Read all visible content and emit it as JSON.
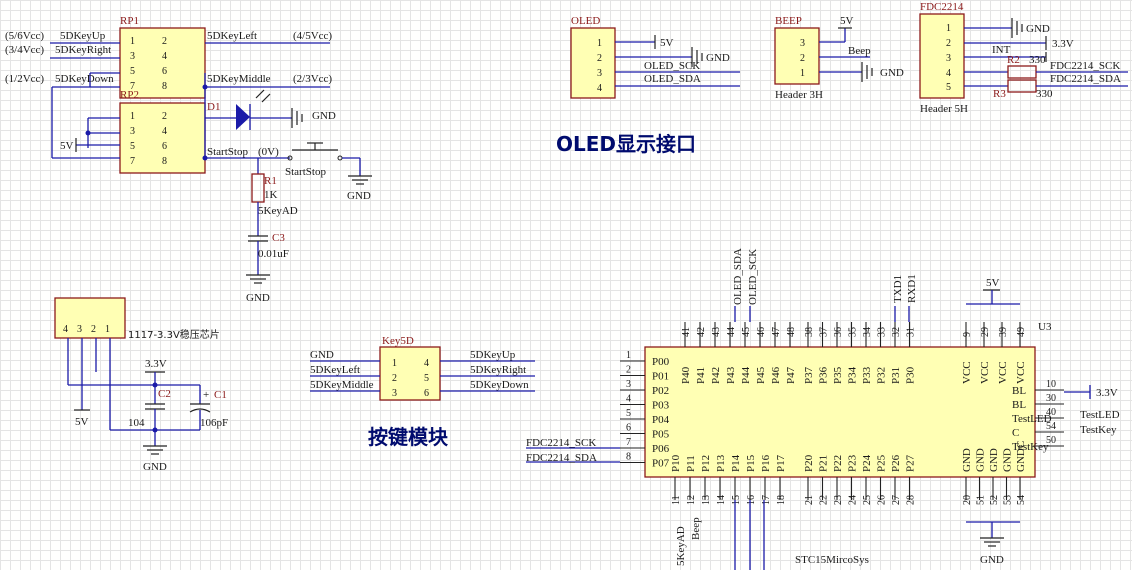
{
  "components": {
    "rp1": {
      "designator": "RP1",
      "pins_left": [
        "1",
        "3",
        "5",
        "7"
      ],
      "pins_right": [
        "2",
        "4",
        "6",
        "8"
      ]
    },
    "rp2": {
      "designator": "RP2",
      "pins_left": [
        "1",
        "3",
        "5",
        "7"
      ],
      "pins_right": [
        "2",
        "4",
        "6",
        "8"
      ]
    },
    "d1": {
      "designator": "D1"
    },
    "r1": {
      "designator": "R1",
      "value": "1K"
    },
    "c3": {
      "designator": "C3",
      "value": "0.01uF"
    },
    "startstop": {
      "label": "StartStop"
    },
    "reg": {
      "label": "1117-3.3V稳压芯片",
      "pins": [
        "4",
        "3",
        "2",
        "1"
      ]
    },
    "c2": {
      "designator": "C2",
      "value": "104"
    },
    "c1": {
      "designator": "C1",
      "value": "106pF"
    },
    "key5d": {
      "designator": "Key5D",
      "pins_left": [
        "1",
        "2",
        "3"
      ],
      "pins_right": [
        "4",
        "5",
        "6"
      ]
    },
    "oled": {
      "designator": "OLED",
      "pins": [
        "1",
        "2",
        "3",
        "4"
      ]
    },
    "beep": {
      "designator": "BEEP",
      "footprint": "Header 3H",
      "pins": [
        "3",
        "2",
        "1"
      ]
    },
    "fdc": {
      "designator": "FDC2214",
      "footprint": "Header 5H",
      "pins": [
        "1",
        "2",
        "3",
        "4",
        "5"
      ]
    },
    "r2": {
      "designator": "R2",
      "value": "330"
    },
    "r3": {
      "designator": "R3",
      "value": "330"
    },
    "u3": {
      "designator": "U3",
      "footer": "STC15MircoSys",
      "left_pins": [
        {
          "num": "1",
          "name": "P00"
        },
        {
          "num": "2",
          "name": "P01"
        },
        {
          "num": "3",
          "name": "P02"
        },
        {
          "num": "4",
          "name": "P03"
        },
        {
          "num": "5",
          "name": "P04"
        },
        {
          "num": "6",
          "name": "P05"
        },
        {
          "num": "7",
          "name": "P06"
        },
        {
          "num": "8",
          "name": "P07"
        }
      ],
      "top_pins": [
        {
          "num": "41",
          "name": "P40"
        },
        {
          "num": "42",
          "name": "P41"
        },
        {
          "num": "43",
          "name": "P42"
        },
        {
          "num": "44",
          "name": "P43"
        },
        {
          "num": "45",
          "name": "P44"
        },
        {
          "num": "46",
          "name": "P45"
        },
        {
          "num": "47",
          "name": "P46"
        },
        {
          "num": "48",
          "name": "P47"
        },
        {
          "num": "38",
          "name": "P37"
        },
        {
          "num": "37",
          "name": "P36"
        },
        {
          "num": "36",
          "name": "P35"
        },
        {
          "num": "35",
          "name": "P34"
        },
        {
          "num": "34",
          "name": "P33"
        },
        {
          "num": "33",
          "name": "P32"
        },
        {
          "num": "32",
          "name": "P31"
        },
        {
          "num": "31",
          "name": "P30"
        },
        {
          "num": "9",
          "name": "VCC"
        },
        {
          "num": "29",
          "name": "VCC"
        },
        {
          "num": "39",
          "name": "VCC"
        },
        {
          "num": "49",
          "name": "VCC"
        }
      ],
      "bottom_pins": [
        {
          "num": "11",
          "name": "P10"
        },
        {
          "num": "12",
          "name": "P11"
        },
        {
          "num": "13",
          "name": "P12"
        },
        {
          "num": "14",
          "name": "P13"
        },
        {
          "num": "15",
          "name": "P14"
        },
        {
          "num": "16",
          "name": "P15"
        },
        {
          "num": "17",
          "name": "P16"
        },
        {
          "num": "18",
          "name": "P17"
        },
        {
          "num": "21",
          "name": "P20"
        },
        {
          "num": "22",
          "name": "P21"
        },
        {
          "num": "23",
          "name": "P22"
        },
        {
          "num": "24",
          "name": "P23"
        },
        {
          "num": "25",
          "name": "P24"
        },
        {
          "num": "26",
          "name": "P25"
        },
        {
          "num": "27",
          "name": "P26"
        },
        {
          "num": "28",
          "name": "P27"
        },
        {
          "num": "20",
          "name": "GND"
        },
        {
          "num": "51",
          "name": "GND"
        },
        {
          "num": "52",
          "name": "GND"
        },
        {
          "num": "53",
          "name": "GND"
        },
        {
          "num": "54",
          "name": "GNDC"
        }
      ],
      "right_pins": [
        {
          "num": "10",
          "name": "BL"
        },
        {
          "num": "30",
          "name": "BL"
        },
        {
          "num": "40",
          "name": "TestLED"
        },
        {
          "num": "54",
          "name": "C"
        },
        {
          "num": "50",
          "name": "TestKey"
        }
      ]
    }
  },
  "nets": {
    "v56": "(5/6Vcc)",
    "v34": "(3/4Vcc)",
    "v12": "(1/2Vcc)",
    "v45": "(4/5Vcc)",
    "v23": "(2/3Vcc)",
    "v0": "(0V)",
    "up": "5DKeyUp",
    "right": "5DKeyRight",
    "down": "5DKeyDown",
    "left": "5DKeyLeft",
    "middle": "5DKeyMiddle",
    "startstop": "StartStop",
    "keyad": "5KeyAD",
    "gnd": "GND",
    "v5": "5V",
    "v33": "3.3V",
    "oled_sck": "OLED_SCK",
    "oled_sda": "OLED_SDA",
    "beep": "Beep",
    "int": "INT",
    "fdc_sck": "FDC2214_SCK",
    "fdc_sda": "FDC2214_SDA",
    "txd": "TXD1",
    "rxd": "RXD1",
    "testled": "TestLED",
    "testkey": "TestKey"
  },
  "headings": {
    "oled": "OLED显示接口",
    "keys": "按键模块"
  }
}
